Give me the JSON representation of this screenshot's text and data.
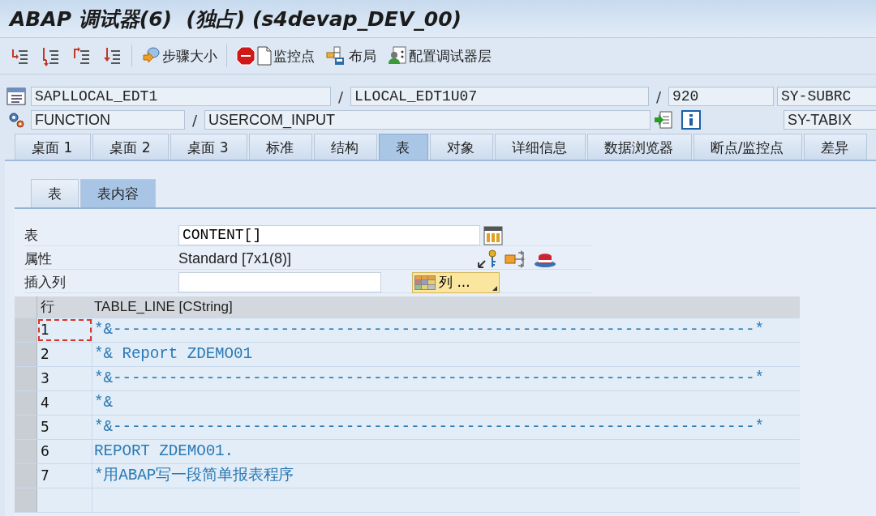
{
  "window": {
    "title": "ABAP 调试器(6)  (独占) (s4devap_DEV_00)"
  },
  "toolbar": [
    {
      "label": "步骤大小"
    },
    {
      "label": "监控点"
    },
    {
      "label": "布局"
    },
    {
      "label": "配置调试器层"
    }
  ],
  "context_rows": [
    {
      "items": [
        {
          "kind": "field",
          "value": "SAPLLOCAL_EDT1"
        },
        {
          "kind": "separator",
          "text": "/"
        },
        {
          "kind": "field",
          "value": "LLOCAL_EDT1U07"
        },
        {
          "kind": "separator",
          "text": "/"
        },
        {
          "kind": "field",
          "value": "920"
        },
        {
          "kind": "field",
          "value": "SY-SUBRC"
        }
      ]
    },
    {
      "items": [
        {
          "kind": "field",
          "value": "FUNCTION"
        },
        {
          "kind": "separator",
          "text": "/"
        },
        {
          "kind": "field",
          "value": "USERCOM_INPUT"
        },
        {
          "kind": "tools"
        },
        {
          "kind": "field",
          "value": "SY-TABIX"
        }
      ]
    }
  ],
  "tabs": [
    {
      "label": "桌面 1",
      "selected": false
    },
    {
      "label": "桌面 2",
      "selected": false
    },
    {
      "label": "桌面 3",
      "selected": false
    },
    {
      "label": "标准",
      "selected": false
    },
    {
      "label": "结构",
      "selected": false
    },
    {
      "label": "表",
      "selected": true
    },
    {
      "label": "对象",
      "selected": false
    },
    {
      "label": "详细信息",
      "selected": false
    },
    {
      "label": "数据浏览器",
      "selected": false
    },
    {
      "label": "断点/监控点",
      "selected": false
    },
    {
      "label": "差异",
      "selected": false
    }
  ],
  "subtabs": [
    {
      "label": "表",
      "selected": false
    },
    {
      "label": "表内容",
      "selected": true
    }
  ],
  "form": {
    "table_label": "表",
    "table_value": "CONTENT[]",
    "attributes_label": "属性",
    "attributes_value": "Standard [7x1(8)]",
    "insert_column_label": "插入列",
    "columns_button": "列 ..."
  },
  "table": {
    "columns": [
      "行",
      "TABLE_LINE [CString]"
    ],
    "rows": [
      {
        "line": "1",
        "text": "*&---------------------------------------------------------------------*",
        "selected": true
      },
      {
        "line": "2",
        "text": "*& Report ZDEMO01",
        "selected": false
      },
      {
        "line": "3",
        "text": "*&---------------------------------------------------------------------*",
        "selected": false
      },
      {
        "line": "4",
        "text": "*&",
        "selected": false
      },
      {
        "line": "5",
        "text": "*&---------------------------------------------------------------------*",
        "selected": false
      },
      {
        "line": "6",
        "text": "REPORT ZDEMO01.",
        "selected": false
      },
      {
        "line": "7",
        "text": "*用ABAP写一段简单报表程序",
        "selected": false
      }
    ]
  }
}
